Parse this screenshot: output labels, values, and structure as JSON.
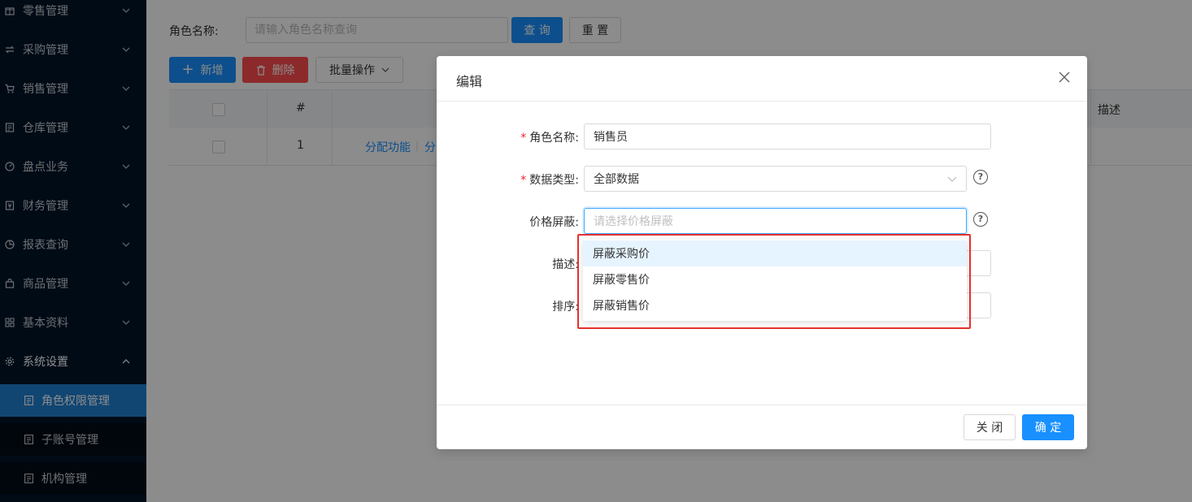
{
  "sidebar": {
    "items": [
      {
        "label": "零售管理",
        "icon": "shop-icon"
      },
      {
        "label": "采购管理",
        "icon": "swap-icon"
      },
      {
        "label": "销售管理",
        "icon": "cart-icon"
      },
      {
        "label": "仓库管理",
        "icon": "warehouse-icon"
      },
      {
        "label": "盘点业务",
        "icon": "dashboard-icon"
      },
      {
        "label": "财务管理",
        "icon": "money-icon"
      },
      {
        "label": "报表查询",
        "icon": "pie-chart-icon"
      },
      {
        "label": "商品管理",
        "icon": "shopping-bag-icon"
      },
      {
        "label": "基本资料",
        "icon": "appstore-icon"
      },
      {
        "label": "系统设置",
        "icon": "gear-icon"
      }
    ],
    "subitems": [
      {
        "label": "角色权限管理",
        "active": true
      },
      {
        "label": "子账号管理",
        "active": false
      },
      {
        "label": "机构管理",
        "active": false
      }
    ]
  },
  "filter": {
    "label": "角色名称:",
    "placeholder": "请输入角色名称查询",
    "query_label": "查 询",
    "reset_label": "重 置"
  },
  "toolbar": {
    "add_label": "新增",
    "delete_label": "删除",
    "batch_label": "批量操作"
  },
  "table": {
    "header_index": "#",
    "header_desc": "描述",
    "row": {
      "index": "1",
      "action1": "分配功能",
      "action2_partial": "分"
    }
  },
  "modal": {
    "title": "编辑",
    "fields": {
      "role_name_label": "角色名称:",
      "role_name_value": "销售员",
      "data_type_label": "数据类型:",
      "data_type_value": "全部数据",
      "price_mask_label": "价格屏蔽:",
      "price_mask_placeholder": "请选择价格屏蔽",
      "desc_label": "描述:",
      "sort_label": "排序:"
    },
    "close_label": "关 闭",
    "ok_label": "确 定"
  },
  "dropdown": {
    "options": [
      "屏蔽采购价",
      "屏蔽零售价",
      "屏蔽销售价"
    ]
  },
  "colors": {
    "sidebar_bg": "#001529",
    "primary": "#1890ff",
    "danger": "#ff4d4f",
    "highlight": "#e5312d"
  }
}
